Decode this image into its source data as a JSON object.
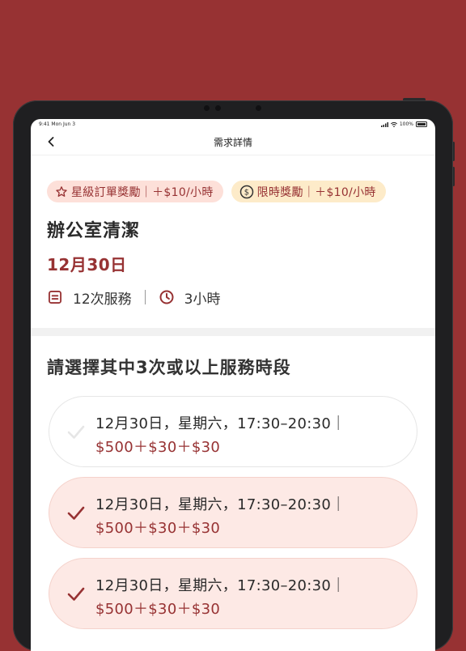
{
  "status_bar": {
    "time": "9:41",
    "date": "Mon Jun 3",
    "battery": "100%"
  },
  "nav": {
    "title": "需求詳情"
  },
  "tags": [
    {
      "label": "星級訂單獎勵｜＋$10/小時",
      "icon": "star-icon"
    },
    {
      "label": "限時獎勵｜＋$10/小時",
      "icon": "dollar-coin-icon"
    }
  ],
  "job": {
    "title": "辦公室清潔",
    "date": "12月30日",
    "sessions": "12次服務",
    "duration": "3小時"
  },
  "section": {
    "title": "請選擇其中3次或以上服務時段"
  },
  "slots": [
    {
      "time": "12月30日，星期六，17:30–20:30｜",
      "price": "$500＋$30＋$30",
      "selected": false
    },
    {
      "time": "12月30日，星期六，17:30–20:30｜",
      "price": "$500＋$30＋$30",
      "selected": true
    },
    {
      "time": "12月30日，星期六，17:30–20:30｜",
      "price": "$500＋$30＋$30",
      "selected": true
    }
  ],
  "colors": {
    "brand": "#973233",
    "selected_bg": "#fde9e5",
    "tag_star_bg": "#fde0d9",
    "tag_time_bg": "#fdebc9"
  }
}
